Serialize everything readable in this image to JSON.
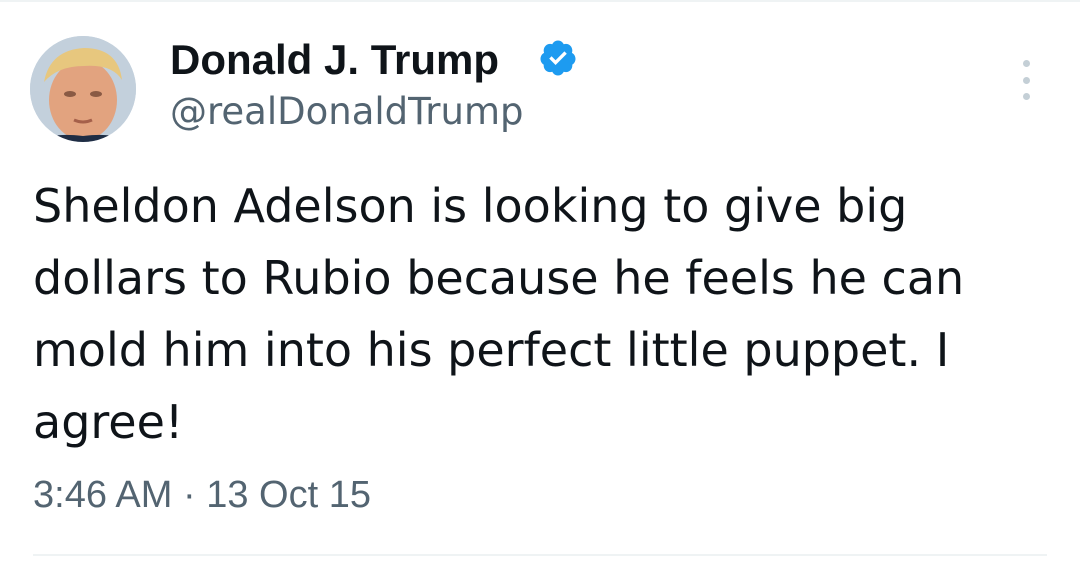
{
  "tweet": {
    "display_name": "Donald J. Trump",
    "handle": "@realDonaldTrump",
    "verified": true,
    "text": "Sheldon Adelson is looking to give big dollars to Rubio because he feels he can mold him into his perfect little puppet. I agree!",
    "timestamp": "3:46 AM · 13 Oct 15"
  },
  "icons": {
    "verified": "verified-badge-icon",
    "more": "more-options-icon"
  },
  "colors": {
    "primary_text": "#0f1419",
    "secondary_text": "#536471",
    "verified_blue": "#1d9bf0",
    "divider": "#eff3f4"
  }
}
